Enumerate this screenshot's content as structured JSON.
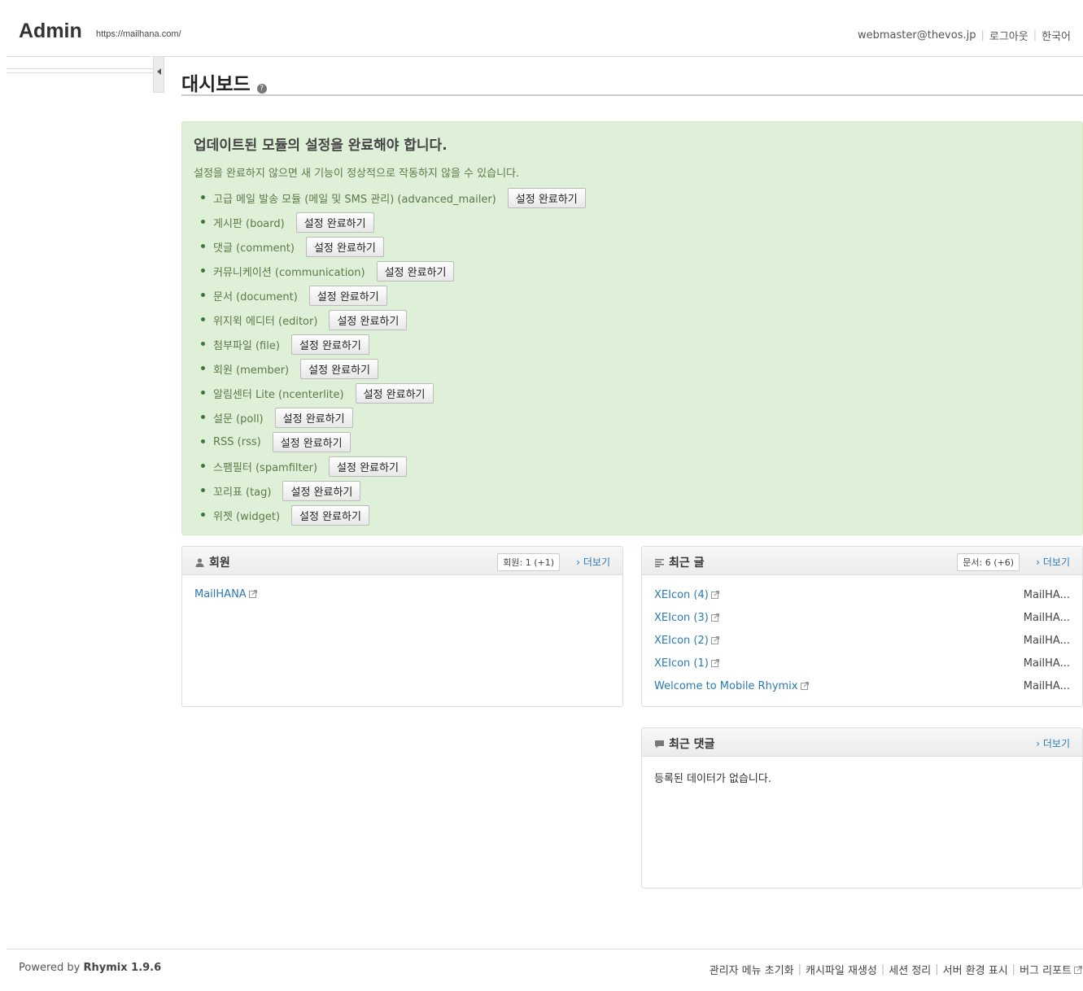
{
  "header": {
    "brand": "Admin",
    "site_url": "https://mailhana.com/",
    "user_email": "webmaster@thevos.jp",
    "logout": "로그아웃",
    "language": "한국어"
  },
  "page": {
    "title": "대시보드",
    "help_glyph": "?"
  },
  "update_panel": {
    "title": "업데이트된 모듈의 설정을 완료해야 합니다.",
    "description": "설정을 완료하지 않으면 새 기능이 정상적으로 작동하지 않을 수 있습니다.",
    "button_label": "설정 완료하기",
    "modules": [
      "고급 메일 발송 모듈 (메일 및 SMS 관리) (advanced_mailer)",
      "게시판 (board)",
      "댓글 (comment)",
      "커뮤니케이션 (communication)",
      "문서 (document)",
      "위지윅 에디터 (editor)",
      "첨부파일 (file)",
      "회원 (member)",
      "알림센터 Lite (ncenterlite)",
      "설문 (poll)",
      "RSS (rss)",
      "스팸필터 (spamfilter)",
      "꼬리표 (tag)",
      "위젯 (widget)"
    ]
  },
  "members_box": {
    "title": "회원",
    "count": "회원: 1 (+1)",
    "more": "더보기",
    "items": [
      "MailHANA"
    ]
  },
  "recent_posts_box": {
    "title": "최근 글",
    "count": "문서: 6 (+6)",
    "more": "더보기",
    "items": [
      {
        "title": "XEIcon (4)",
        "author": "MailHA..."
      },
      {
        "title": "XEIcon (3)",
        "author": "MailHA..."
      },
      {
        "title": "XEIcon (2)",
        "author": "MailHA..."
      },
      {
        "title": "XEIcon (1)",
        "author": "MailHA..."
      },
      {
        "title": "Welcome to Mobile Rhymix",
        "author": "MailHA..."
      }
    ]
  },
  "recent_comments_box": {
    "title": "최근 댓글",
    "more": "더보기",
    "empty": "등록된 데이터가 없습니다."
  },
  "footer": {
    "powered_prefix": "Powered by",
    "powered_name": "Rhymix 1.9.6",
    "links": [
      "관리자 메뉴 초기화",
      "캐시파일 재생성",
      "세션 정리",
      "서버 환경 표시",
      "버그 리포트"
    ]
  }
}
